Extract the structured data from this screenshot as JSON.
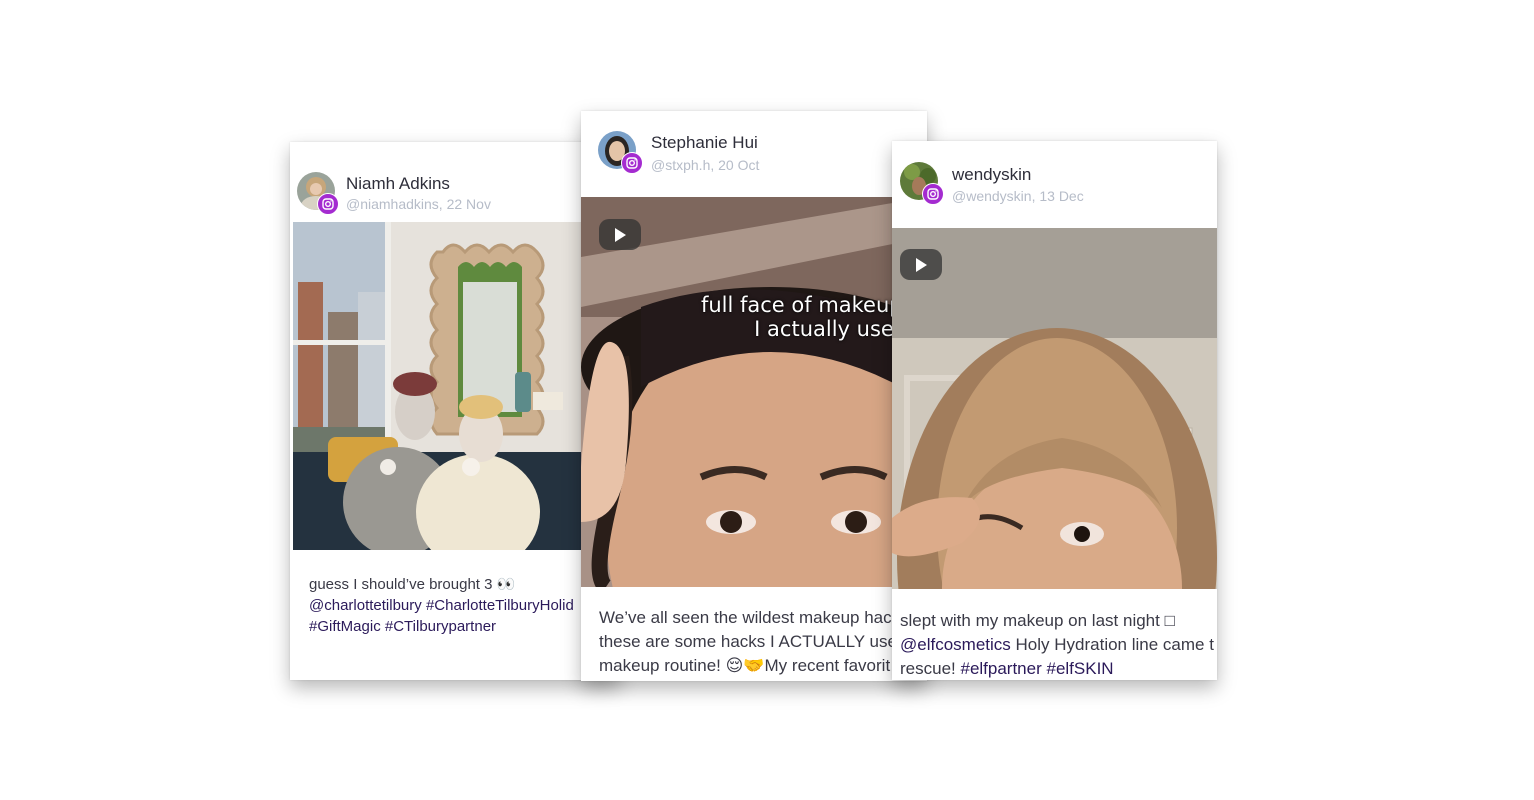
{
  "posts": [
    {
      "author": "Niamh Adkins",
      "handle": "@niamhadkins, 22 Nov",
      "platform_icon": "instagram-icon",
      "media_type": "image",
      "caption_line1": "guess I should’ve brought 3 👀",
      "caption_line2_tag1": "@charlottetilbury",
      "caption_line2_tag2": "#CharlotteTilburyHolid",
      "caption_line3_tag1": "#GiftMagic",
      "caption_line3_tag2": "#CTilburypartner"
    },
    {
      "author": "Stephanie Hui",
      "handle": "@stxph.h, 20 Oct",
      "platform_icon": "instagram-icon",
      "media_type": "video",
      "overlay_line1": "full face of makeup hac",
      "overlay_line2": "I actually use",
      "caption_line1": "We’ve all seen the wildest makeup hac",
      "caption_line2": "these are some hacks I ACTUALLY use",
      "caption_line3": "makeup routine! 😌🤝My recent favorit"
    },
    {
      "author": "wendyskin",
      "handle": "@wendyskin, 13 Dec",
      "platform_icon": "instagram-icon",
      "media_type": "video",
      "caption_line1": "slept with my makeup on last night □",
      "caption_line2_tag": "@elfcosmetics",
      "caption_line2_text": " Holy Hydration line came t",
      "caption_line3_text": "rescue! ",
      "caption_line3_tag1": "#elfpartner",
      "caption_line3_tag2": "#elfSKIN"
    }
  ],
  "colors": {
    "instagram_badge": "#a42bd0",
    "hashtag": "#2b1a5a",
    "handle": "#b6bcc8"
  }
}
